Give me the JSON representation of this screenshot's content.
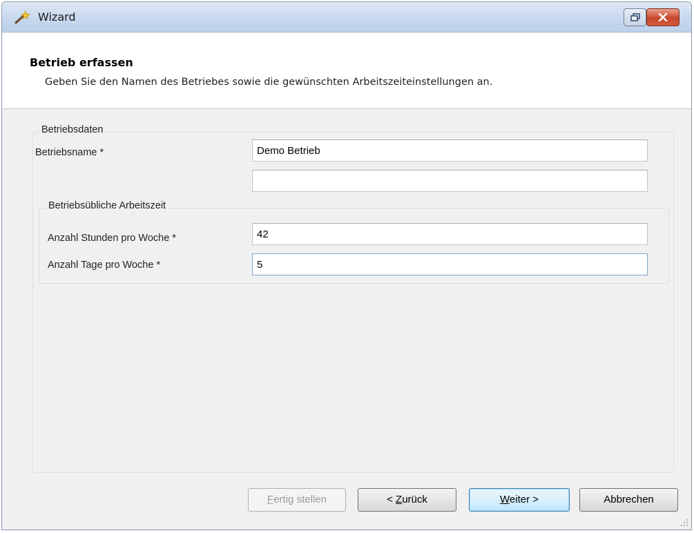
{
  "window": {
    "title": "Wizard"
  },
  "header": {
    "title": "Betrieb erfassen",
    "description": "Geben Sie den Namen des Betriebes sowie die gewünschten Arbeitszeiteinstellungen an."
  },
  "betriebsdaten": {
    "legend": "Betriebsdaten",
    "name_label": "Betriebsname *",
    "name_value": "Demo Betrieb",
    "name2_value": ""
  },
  "arbeitszeit": {
    "legend": "Betriebsübliche Arbeitszeit",
    "hours_label": "Anzahl Stunden pro Woche *",
    "hours_value": "42",
    "days_label": "Anzahl Tage pro Woche *",
    "days_value": "5"
  },
  "buttons": {
    "finish": {
      "mnemonic": "F",
      "rest": "ertig stellen"
    },
    "back": {
      "prefix": "< ",
      "mnemonic": "Z",
      "rest": "urück"
    },
    "next": {
      "mnemonic": "W",
      "rest": "eiter >"
    },
    "cancel": "Abbrechen"
  },
  "colors": {
    "accent_default_button": "#3c7fb1",
    "close_button": "#c8452d"
  }
}
